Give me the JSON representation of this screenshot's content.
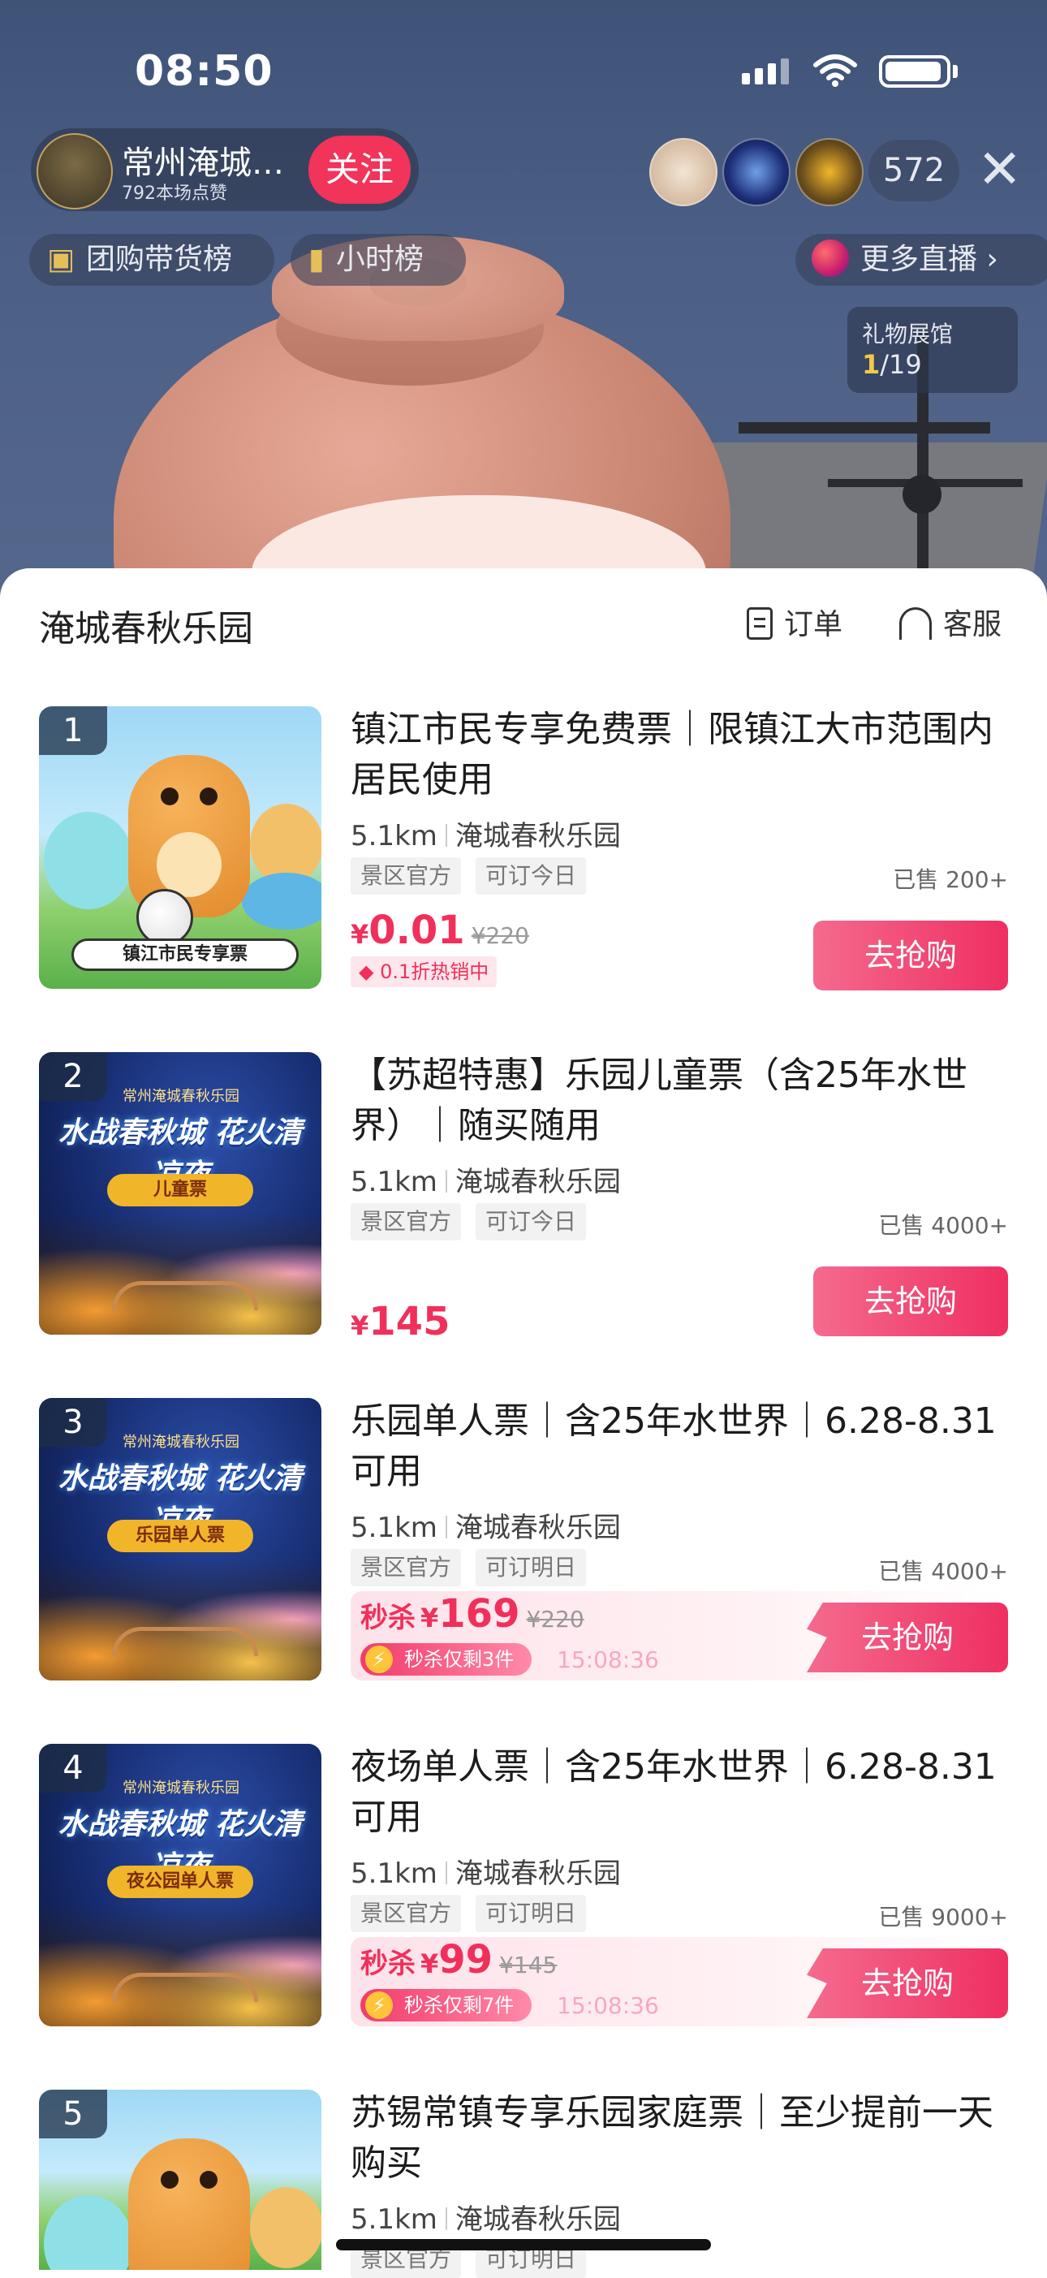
{
  "status_bar": {
    "time": "08:50"
  },
  "stream": {
    "streamer_name": "常州淹城…",
    "likes": "792本场点赞",
    "follow_label": "关注",
    "viewer_count": "572",
    "rank_chip": "团购带货榜",
    "hour_chip": "小时榜",
    "more_live": "更多直播 ›",
    "gift_title": "礼物展馆",
    "gift_current": "1",
    "gift_total": "/19"
  },
  "sheet": {
    "title": "淹城春秋乐园",
    "order_label": "订单",
    "service_label": "客服"
  },
  "products": [
    {
      "rank": "1",
      "title": "镇江市民专享免费票｜限镇江大市范围内居民使用",
      "distance": "5.1km",
      "venue": "淹城春秋乐园",
      "tags": [
        "景区官方",
        "可订今日"
      ],
      "sold": "已售 200+",
      "price_symbol": "¥",
      "price": "0.01",
      "original_price": "¥220",
      "discount_badge": "0.1折热销中",
      "button": "去抢购",
      "thumb_banner": "镇江市民专享票"
    },
    {
      "rank": "2",
      "title": "【苏超特惠】乐园儿童票（含25年水世界）｜随买随用",
      "distance": "5.1km",
      "venue": "淹城春秋乐园",
      "tags": [
        "景区官方",
        "可订今日"
      ],
      "sold": "已售 4000+",
      "price_symbol": "¥",
      "price": "145",
      "button": "去抢购",
      "thumb_title": "水战春秋城 花火清凉夜",
      "thumb_sub": "常州淹城春秋乐园",
      "thumb_tag": "儿童票"
    },
    {
      "rank": "3",
      "title": "乐园单人票｜含25年水世界｜6.28-8.31可用",
      "distance": "5.1km",
      "venue": "淹城春秋乐园",
      "tags": [
        "景区官方",
        "可订明日"
      ],
      "sold": "已售 4000+",
      "flash_label": "秒杀",
      "price_symbol": "¥",
      "price": "169",
      "original_price": "¥220",
      "stock_badge": "秒杀仅剩3件",
      "countdown": "15:08:36",
      "button": "去抢购",
      "thumb_title": "水战春秋城 花火清凉夜",
      "thumb_sub": "常州淹城春秋乐园",
      "thumb_tag": "乐园单人票"
    },
    {
      "rank": "4",
      "title": "夜场单人票｜含25年水世界｜6.28-8.31可用",
      "distance": "5.1km",
      "venue": "淹城春秋乐园",
      "tags": [
        "景区官方",
        "可订明日"
      ],
      "sold": "已售 9000+",
      "flash_label": "秒杀",
      "price_symbol": "¥",
      "price": "99",
      "original_price": "¥145",
      "stock_badge": "秒杀仅剩7件",
      "countdown": "15:08:36",
      "button": "去抢购",
      "thumb_title": "水战春秋城 花火清凉夜",
      "thumb_sub": "常州淹城春秋乐园",
      "thumb_tag": "夜公园单人票"
    },
    {
      "rank": "5",
      "title": "苏锡常镇专享乐园家庭票｜至少提前一天购买",
      "distance": "5.1km",
      "venue": "淹城春秋乐园",
      "tags": [
        "景区官方",
        "可订明日"
      ]
    }
  ],
  "colors": {
    "accent": "#f0305b",
    "button": "#ee2f62",
    "flash_bg": "#fde2ea"
  }
}
